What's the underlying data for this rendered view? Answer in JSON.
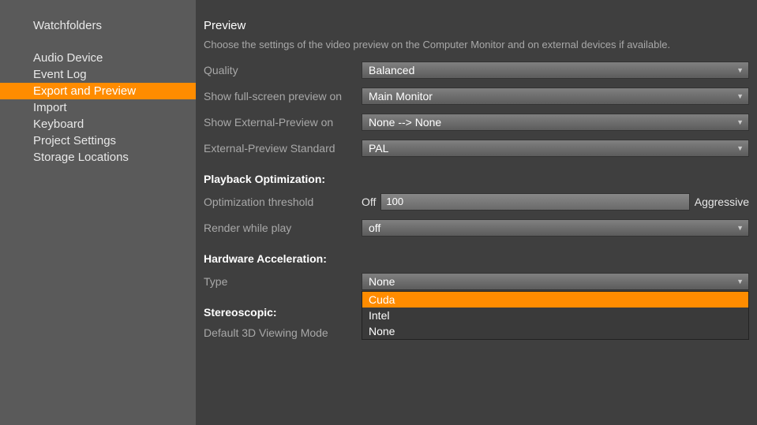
{
  "sidebar": {
    "header": "Watchfolders",
    "items": [
      {
        "label": "Audio Device",
        "active": false
      },
      {
        "label": "Event Log",
        "active": false
      },
      {
        "label": "Export and Preview",
        "active": true
      },
      {
        "label": "Import",
        "active": false
      },
      {
        "label": "Keyboard",
        "active": false
      },
      {
        "label": "Project Settings",
        "active": false
      },
      {
        "label": "Storage Locations",
        "active": false
      }
    ]
  },
  "preview": {
    "title": "Preview",
    "desc": "Choose the settings of the video preview on the Computer Monitor and on external devices if available.",
    "quality": {
      "label": "Quality",
      "value": "Balanced"
    },
    "fullscreen": {
      "label": "Show full-screen preview on",
      "value": "Main Monitor"
    },
    "external": {
      "label": "Show External-Preview on",
      "value": "None --> None"
    },
    "standard": {
      "label": "External-Preview Standard",
      "value": "PAL"
    }
  },
  "playback": {
    "header": "Playback Optimization:",
    "threshold": {
      "label": "Optimization threshold",
      "left": "Off",
      "value": "100",
      "right": "Aggressive"
    },
    "render": {
      "label": "Render while play",
      "value": "off"
    }
  },
  "hardware": {
    "header": "Hardware Acceleration:",
    "type": {
      "label": "Type",
      "value": "None"
    },
    "options": [
      {
        "label": "Cuda",
        "highlighted": true
      },
      {
        "label": "Intel",
        "highlighted": false
      },
      {
        "label": "None",
        "highlighted": false
      }
    ]
  },
  "stereo": {
    "header": "Stereoscopic:",
    "mode": {
      "label": "Default 3D Viewing Mode"
    }
  }
}
